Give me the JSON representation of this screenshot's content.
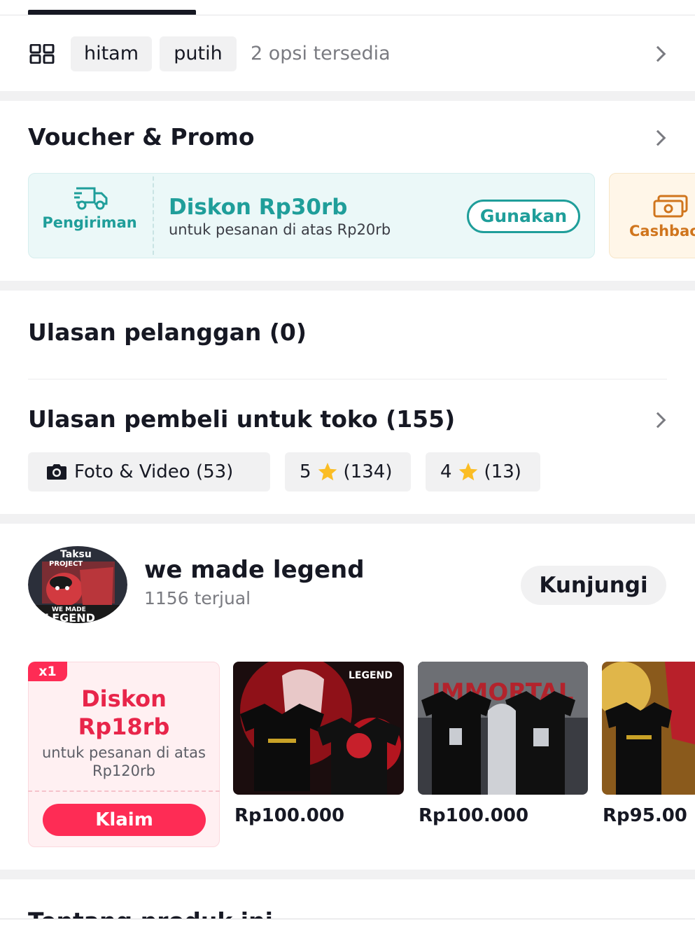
{
  "variants": {
    "chips": [
      "hitam",
      "putih"
    ],
    "count_text": "2 opsi tersedia"
  },
  "voucher_section": {
    "title": "Voucher & Promo",
    "shipping_voucher": {
      "type_label": "Pengiriman",
      "title": "Diskon Rp30rb",
      "subtitle": "untuk pesanan di atas Rp20rb",
      "button_label": "Gunakan"
    },
    "cashback_voucher": {
      "type_label": "Cashback"
    },
    "colors": {
      "accent_teal": "#1f9e9a",
      "cashback_orange": "#d0751d"
    }
  },
  "customer_reviews": {
    "title": "Ulasan pelanggan (0)"
  },
  "shop_reviews": {
    "title": "Ulasan pembeli untuk toko (155)",
    "filters": {
      "photo_video": "Foto & Video (53)",
      "five_star_value": "5",
      "five_star_count": "(134)",
      "four_star_value": "4",
      "four_star_count": "(13)"
    }
  },
  "shop": {
    "name": "we made legend",
    "sold": "1156 terjual",
    "visit_label": "Kunjungi",
    "avatar_text": {
      "top": "Taksu",
      "sub": "PROJECT",
      "bottom1": "WE MADE",
      "bottom2": "LEGEND"
    },
    "voucher": {
      "tag": "x1",
      "title_line1": "Diskon",
      "title_line2": "Rp18rb",
      "subtitle": "untuk pesanan di atas Rp120rb",
      "claim_label": "Klaim"
    },
    "products": [
      {
        "price": "Rp100.000",
        "image_text": "LEGEND"
      },
      {
        "price": "Rp100.000",
        "image_text": "IMMORTAL"
      },
      {
        "price": "Rp95.00"
      }
    ],
    "colors": {
      "brand_red": "#fe2c55"
    }
  },
  "about": {
    "title": "Tentang produk ini"
  }
}
